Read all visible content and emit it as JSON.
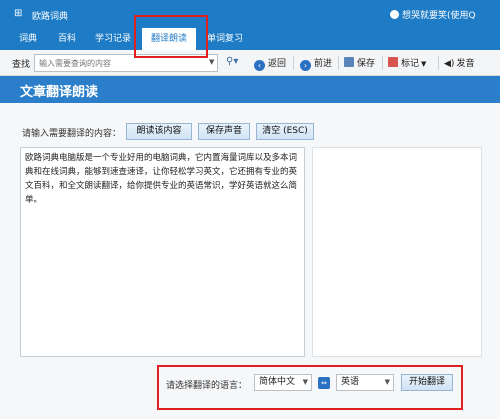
{
  "titlebar": {
    "app_title": "欧路词典",
    "user": "想哭就要笑(使用Q"
  },
  "tabs": [
    {
      "label": "词典"
    },
    {
      "label": "百科"
    },
    {
      "label": "学习记录"
    },
    {
      "label": "翻译朗读"
    },
    {
      "label": "单词复习"
    }
  ],
  "active_tab": "翻译朗读",
  "toolbar": {
    "search_label": "查找",
    "search_placeholder": "输入需要查询的内容",
    "back": "返回",
    "forward": "前进",
    "save": "保存",
    "bookmark": "标记",
    "speak": "发音"
  },
  "section": {
    "title": "文章翻译朗读"
  },
  "input_prompt": "请输入需要翻译的内容：",
  "buttons": {
    "read_aloud": "朗读该内容",
    "save_audio": "保存声音",
    "clear": "清空 (ESC)"
  },
  "input_text": "欧路词典电脑版是一个专业好用的电脑词典，它内置海量词库以及多本词典和在线词典，能够到速查速译，让你轻松学习英文，它还拥有专业的英文百科，和全文朗读翻译，给你提供专业的英语常识，学好英语就这么简单。",
  "language": {
    "label": "请选择翻译的语言：",
    "source": "简体中文",
    "target": "英语",
    "translate_button": "开始翻译"
  },
  "colors": {
    "brand_blue": "#1e7bc5",
    "section_blue": "#2b7fca",
    "annotation_red": "#e02020"
  }
}
